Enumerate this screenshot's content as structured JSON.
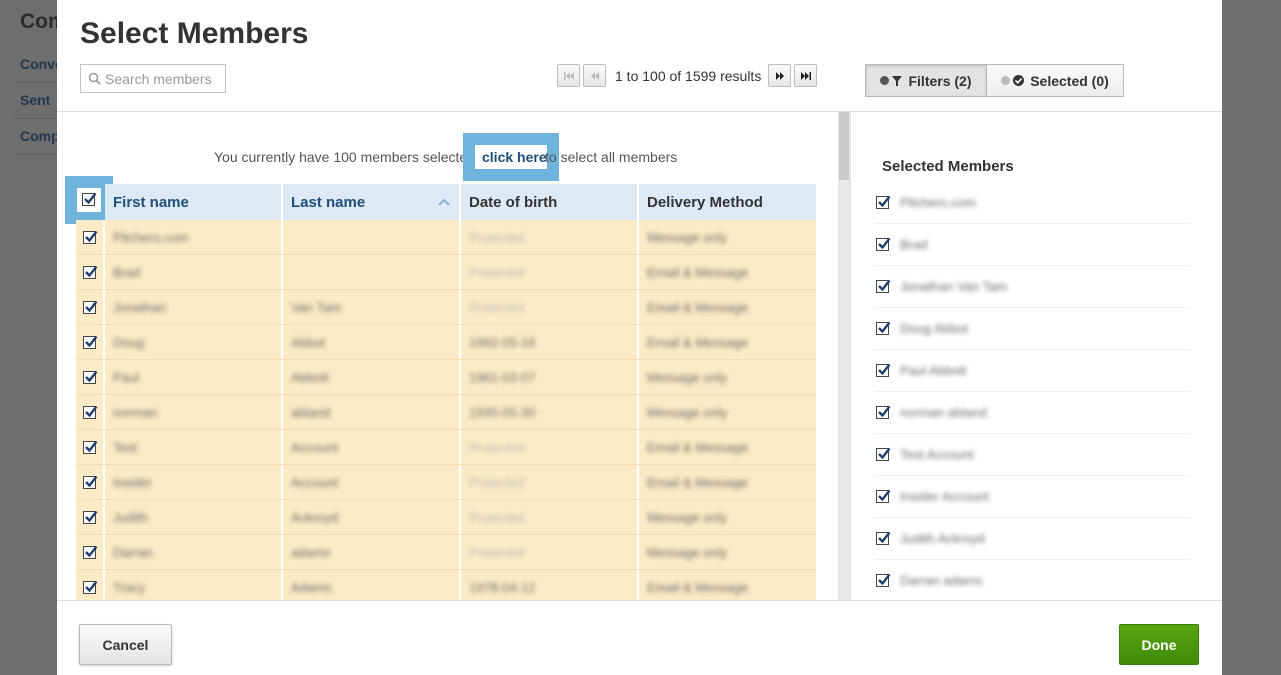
{
  "background": {
    "title": "Com",
    "nav": [
      "Conve",
      "Sent",
      "Comp"
    ]
  },
  "modal": {
    "title": "Select Members",
    "search": {
      "placeholder": "Search members",
      "value": ""
    },
    "pager": {
      "text": "1 to 100 of 1599 results"
    },
    "tabs": {
      "filters": "Filters (2)",
      "selected": "Selected (0)"
    },
    "notice": {
      "pre": "You currently have 100 members selected -",
      "link": "click here",
      "post": "to select all members"
    },
    "columns": [
      "First name",
      "Last name",
      "Date of birth",
      "Delivery Method"
    ],
    "rows": [
      {
        "first": "Pitchero.com",
        "last": "",
        "dob": "Protected",
        "delivery": "Message only"
      },
      {
        "first": "Brad",
        "last": "",
        "dob": "Protected",
        "delivery": "Email & Message"
      },
      {
        "first": "Jonathan",
        "last": "Van Tam",
        "dob": "Protected",
        "delivery": "Email & Message"
      },
      {
        "first": "Doug",
        "last": "Abbot",
        "dob": "1992-05-16",
        "delivery": "Email & Message"
      },
      {
        "first": "Paul",
        "last": "Abbott",
        "dob": "1961-03-07",
        "delivery": "Message only"
      },
      {
        "first": "norman",
        "last": "abland",
        "dob": "1935-05-30",
        "delivery": "Message only"
      },
      {
        "first": "Test",
        "last": "Account",
        "dob": "Protected",
        "delivery": "Email & Message"
      },
      {
        "first": "Insider",
        "last": "Account",
        "dob": "Protected",
        "delivery": "Email & Message"
      },
      {
        "first": "Judith",
        "last": "Ackroyd",
        "dob": "Protected",
        "delivery": "Message only"
      },
      {
        "first": "Darran",
        "last": "adams",
        "dob": "Protected",
        "delivery": "Message only"
      },
      {
        "first": "Tracy",
        "last": "Adams",
        "dob": "1978-04-12",
        "delivery": "Email & Message"
      }
    ],
    "selected_panel": {
      "title": "Selected Members",
      "items": [
        "Pitchero.com",
        "Brad",
        "Jonathan Van Tam",
        "Doug Abbot",
        "Paul Abbott",
        "norman abland",
        "Test Account",
        "Insider Account",
        "Judith Ackroyd",
        "Darran adams"
      ]
    },
    "footer": {
      "cancel": "Cancel",
      "done": "Done"
    }
  },
  "colors": {
    "accent_blue": "#6fb3dc",
    "row_highlight": "#fbeac6",
    "header_bg": "#ddeaf5",
    "done_green": "#4a9a0c"
  }
}
